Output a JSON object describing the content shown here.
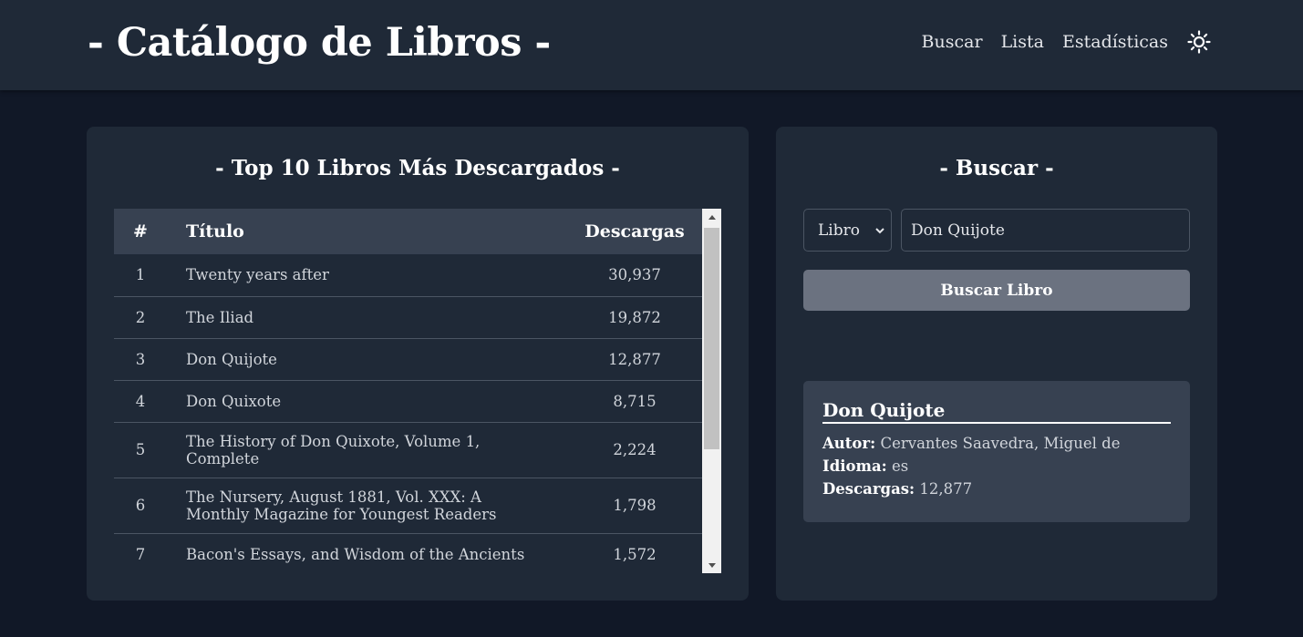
{
  "header": {
    "title": "- Catálogo de Libros -",
    "nav": [
      "Buscar",
      "Lista",
      "Estadísticas"
    ],
    "theme_icon": "sun-icon"
  },
  "top_books": {
    "title": "- Top 10 Libros Más Descargados -",
    "columns": [
      "#",
      "Título",
      "Descargas"
    ],
    "rows": [
      {
        "rank": "1",
        "title": "Twenty years after",
        "downloads": "30,937"
      },
      {
        "rank": "2",
        "title": "The Iliad",
        "downloads": "19,872"
      },
      {
        "rank": "3",
        "title": "Don Quijote",
        "downloads": "12,877"
      },
      {
        "rank": "4",
        "title": "Don Quixote",
        "downloads": "8,715"
      },
      {
        "rank": "5",
        "title": "The History of Don Quixote, Volume 1, Complete",
        "downloads": "2,224"
      },
      {
        "rank": "6",
        "title": "The Nursery, August 1881, Vol. XXX: A Monthly Magazine for Youngest Readers",
        "downloads": "1,798"
      },
      {
        "rank": "7",
        "title": "Bacon's Essays, and Wisdom of the Ancients",
        "downloads": "1,572"
      }
    ]
  },
  "search": {
    "title": "- Buscar -",
    "type_selected": "Libro",
    "query": "Don Quijote",
    "button_label": "Buscar Libro",
    "result": {
      "title": "Don Quijote",
      "author_label": "Autor:",
      "author": "Cervantes Saavedra, Miguel de",
      "language_label": "Idioma:",
      "language": "es",
      "downloads_label": "Descargas:",
      "downloads": "12,877"
    }
  }
}
